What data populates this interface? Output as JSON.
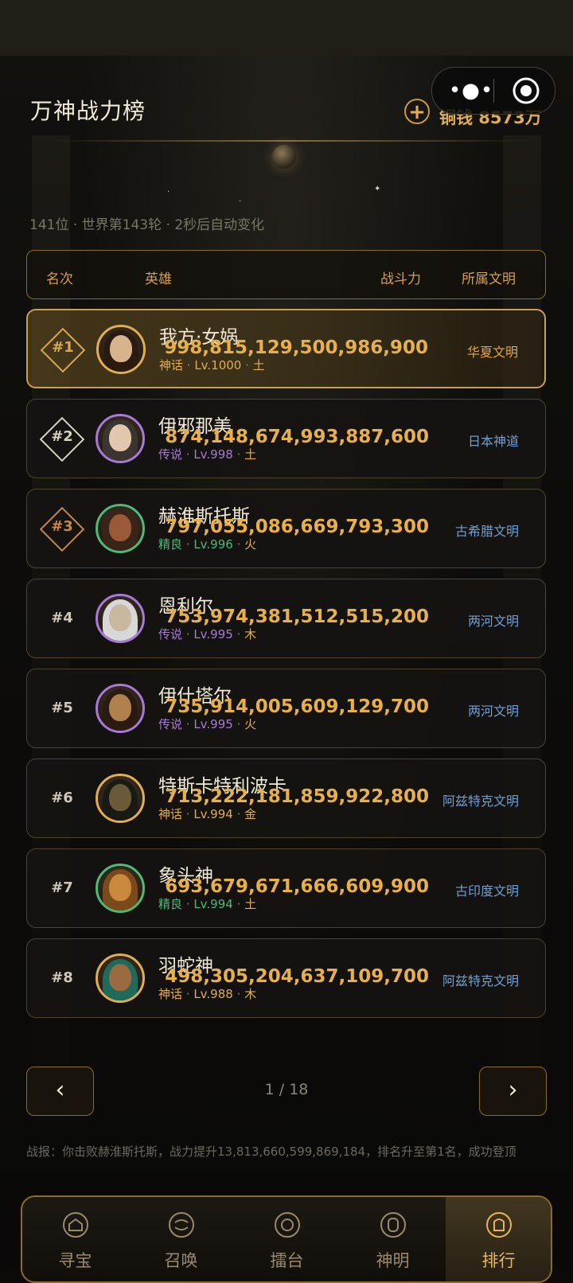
{
  "header": {
    "title": "万神战力榜",
    "currency_label": "铜钱 8573万"
  },
  "subinfo": "141位 · 世界第143轮 · 2秒后自动变化",
  "table_header": {
    "rank": "名次",
    "hero": "英雄",
    "power": "战斗力",
    "civ": "所属文明"
  },
  "rows": [
    {
      "rank": "#1",
      "name": "我方·女娲",
      "rarity": "神话",
      "level": "Lv.1000",
      "element": "土",
      "power": "998,815,129,500,986,900",
      "civ": "华夏文明",
      "rarity_color": "#e0ad52",
      "civ_color": "#e3a64a"
    },
    {
      "rank": "#2",
      "name": "伊邪那美",
      "rarity": "传说",
      "level": "Lv.998",
      "element": "土",
      "power": "874,148,674,993,887,600",
      "civ": "日本神道",
      "rarity_color": "#a77ad8",
      "civ_color": "#6f9fd3"
    },
    {
      "rank": "#3",
      "name": "赫淮斯托斯",
      "rarity": "精良",
      "level": "Lv.996",
      "element": "火",
      "power": "797,055,086,669,793,300",
      "civ": "古希腊文明",
      "rarity_color": "#4fb87a",
      "civ_color": "#6f9fd3"
    },
    {
      "rank": "#4",
      "name": "恩利尔",
      "rarity": "传说",
      "level": "Lv.995",
      "element": "木",
      "power": "753,974,381,512,515,200",
      "civ": "两河文明",
      "rarity_color": "#a77ad8",
      "civ_color": "#6f9fd3"
    },
    {
      "rank": "#5",
      "name": "伊什塔尔",
      "rarity": "传说",
      "level": "Lv.995",
      "element": "火",
      "power": "735,914,005,609,129,700",
      "civ": "两河文明",
      "rarity_color": "#a77ad8",
      "civ_color": "#6f9fd3"
    },
    {
      "rank": "#6",
      "name": "特斯卡特利波卡",
      "rarity": "神话",
      "level": "Lv.994",
      "element": "金",
      "power": "713,222,181,859,922,800",
      "civ": "阿兹特克文明",
      "rarity_color": "#e0ad52",
      "civ_color": "#6f9fd3"
    },
    {
      "rank": "#7",
      "name": "象头神",
      "rarity": "精良",
      "level": "Lv.994",
      "element": "土",
      "power": "693,679,671,666,609,900",
      "civ": "古印度文明",
      "rarity_color": "#4fb87a",
      "civ_color": "#6f9fd3"
    },
    {
      "rank": "#8",
      "name": "羽蛇神",
      "rarity": "神话",
      "level": "Lv.988",
      "element": "木",
      "power": "498,305,204,637,109,700",
      "civ": "阿兹特克文明",
      "rarity_color": "#e0ad52",
      "civ_color": "#6f9fd3"
    }
  ],
  "pagination": {
    "prev": "‹",
    "next": "›",
    "text": "1 / 18"
  },
  "report": "战报：你击败赫淮斯托斯，战力提升13,813,660,599,869,184，排名升至第1名，成功登顶",
  "tabs": [
    {
      "label": "寻宝",
      "icon": "treasure-icon"
    },
    {
      "label": "召唤",
      "icon": "summon-icon"
    },
    {
      "label": "擂台",
      "icon": "arena-icon"
    },
    {
      "label": "神明",
      "icon": "deity-icon"
    },
    {
      "label": "排行",
      "icon": "ranking-icon",
      "active": true
    }
  ],
  "colors": {
    "accent": "#e0ad52",
    "border_gold": "#8c6a2c",
    "legend": "#a77ad8",
    "rare": "#4fb87a",
    "civ_blue": "#6f9fd3"
  }
}
